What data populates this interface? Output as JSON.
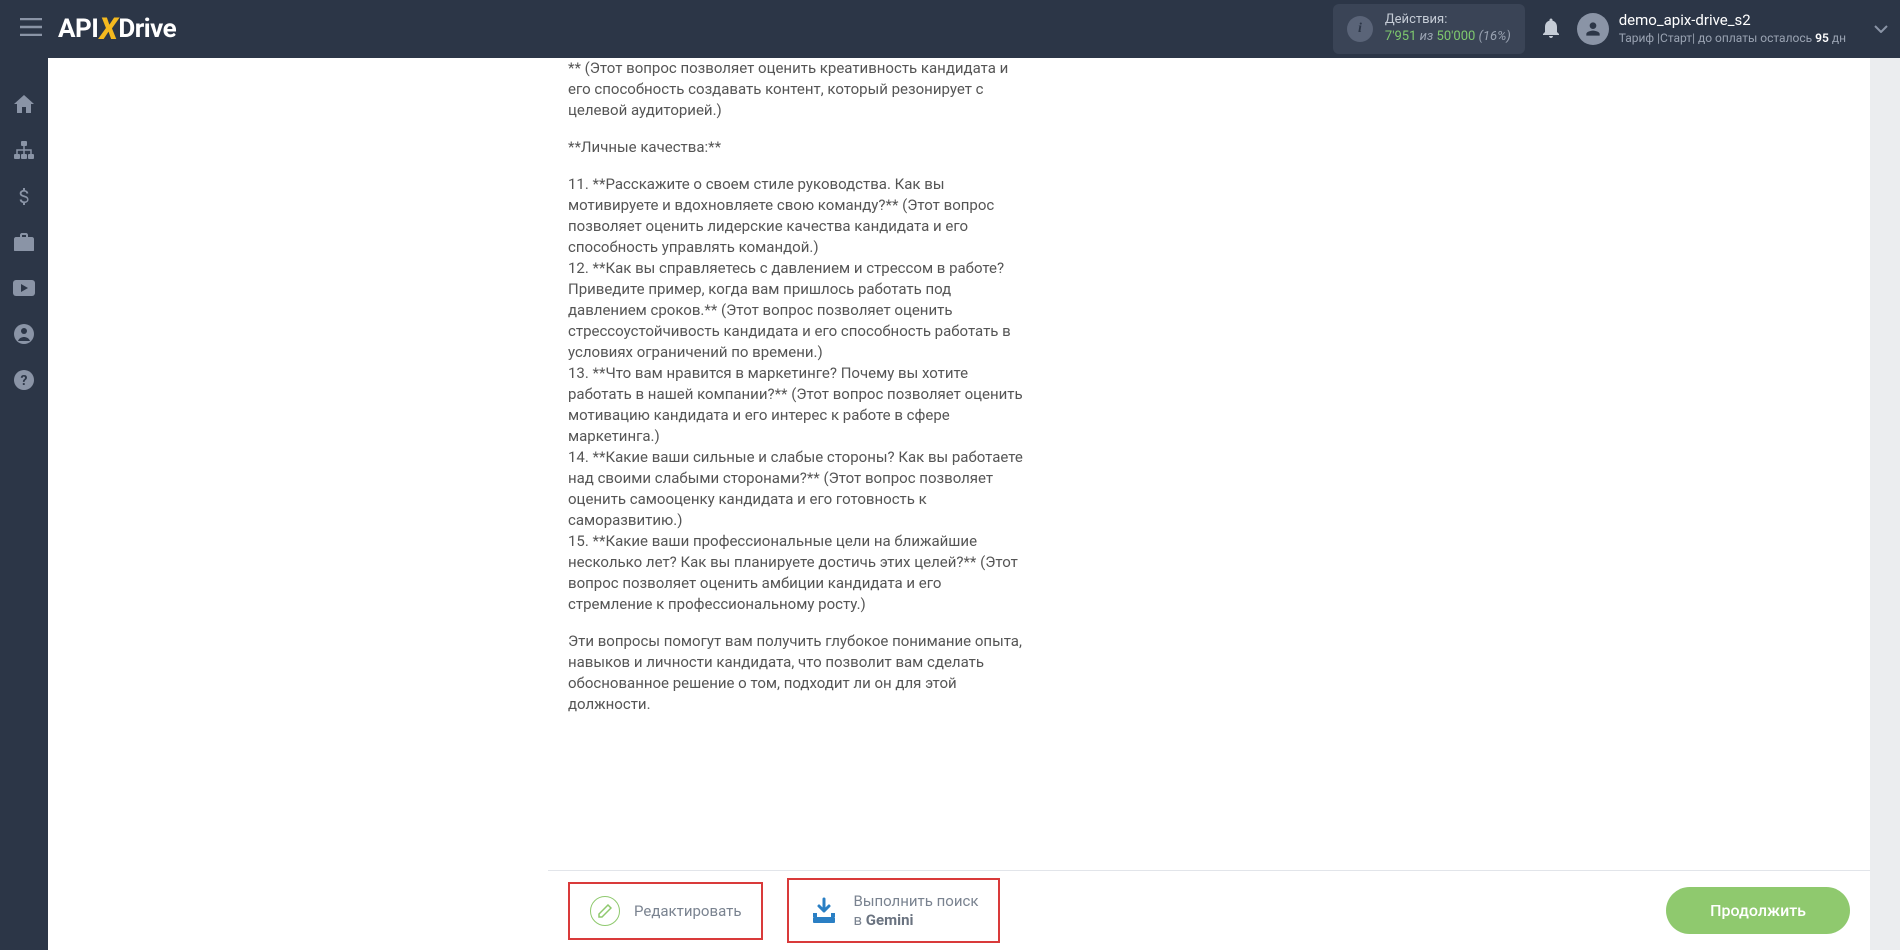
{
  "header": {
    "actions_label": "Действия:",
    "actions_used": "7'951",
    "actions_of": "из",
    "actions_total": "50'000",
    "actions_pct": "(16%)",
    "user_name": "demo_apix-drive_s2",
    "plan_prefix": "Тариф |Старт| до оплаты осталось ",
    "plan_days": "95",
    "plan_suffix": " дн"
  },
  "content": {
    "p0": "** (Этот вопрос позволяет оценить креативность кандидата и его способность создавать контент, который резонирует с целевой аудиторией.)",
    "p1": "**Личные качества:**",
    "p2": "11. **Расскажите о своем стиле руководства. Как вы мотивируете и вдохновляете свою команду?** (Этот вопрос позволяет оценить лидерские качества кандидата и его способность управлять командой.)",
    "p3": "12. **Как вы справляетесь с давлением и стрессом в работе? Приведите пример, когда вам пришлось работать под давлением сроков.** (Этот вопрос позволяет оценить стрессоустойчивость кандидата и его способность работать в условиях ограничений по времени.)",
    "p4": "13. **Что вам нравится в маркетинге? Почему вы хотите работать в нашей компании?** (Этот вопрос позволяет оценить мотивацию кандидата и его интерес к работе в сфере маркетинга.)",
    "p5": "14. **Какие ваши сильные и слабые стороны? Как вы работаете над своими слабыми сторонами?** (Этот вопрос позволяет оценить самооценку кандидата и его готовность к саморазвитию.)",
    "p6": "15. **Какие ваши профессиональные цели на ближайшие несколько лет? Как вы планируете достичь этих целей?** (Этот вопрос позволяет оценить амбиции кандидата и его стремление к профессиональному росту.)",
    "p7": "Эти вопросы помогут вам получить глубокое понимание опыта, навыков и личности кандидата, что позволит вам сделать обоснованное решение о том, подходит ли он для этой должности."
  },
  "footer": {
    "edit": "Редактировать",
    "search_line1": "Выполнить поиск",
    "search_line2_prefix": "в ",
    "search_line2_bold": "Gemini",
    "continue": "Продолжить"
  }
}
